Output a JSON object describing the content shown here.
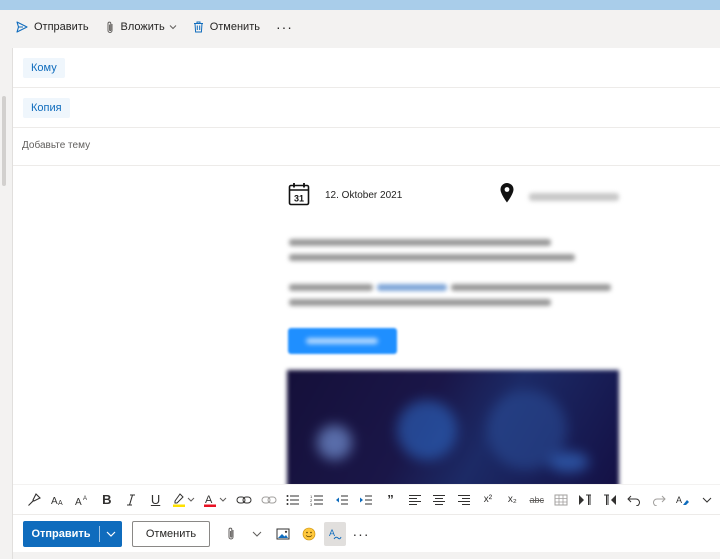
{
  "toolbar": {
    "send_label": "Отправить",
    "attach_label": "Вложить",
    "discard_label": "Отменить",
    "more_label": "···",
    "icons": {
      "send": "send-icon",
      "attach": "paperclip-icon",
      "discard": "trash-icon"
    }
  },
  "recipients": {
    "to_label": "Кому",
    "cc_label": "Копия"
  },
  "subject": {
    "placeholder": "Добавьте тему"
  },
  "message": {
    "date": "12. Oktober 2021"
  },
  "format_toolbar": {
    "bold": "B",
    "underline": "U",
    "quote": "”",
    "superscript": "x²",
    "subscript": "x₂",
    "strikethrough": "abc"
  },
  "sendbar": {
    "send_label": "Отправить",
    "discard_label": "Отменить",
    "more_label": "···"
  },
  "colors": {
    "accent": "#0f6cbd",
    "topbar": "#a9cdea",
    "highlight": "#ffe100",
    "font_color": "#e81123"
  }
}
